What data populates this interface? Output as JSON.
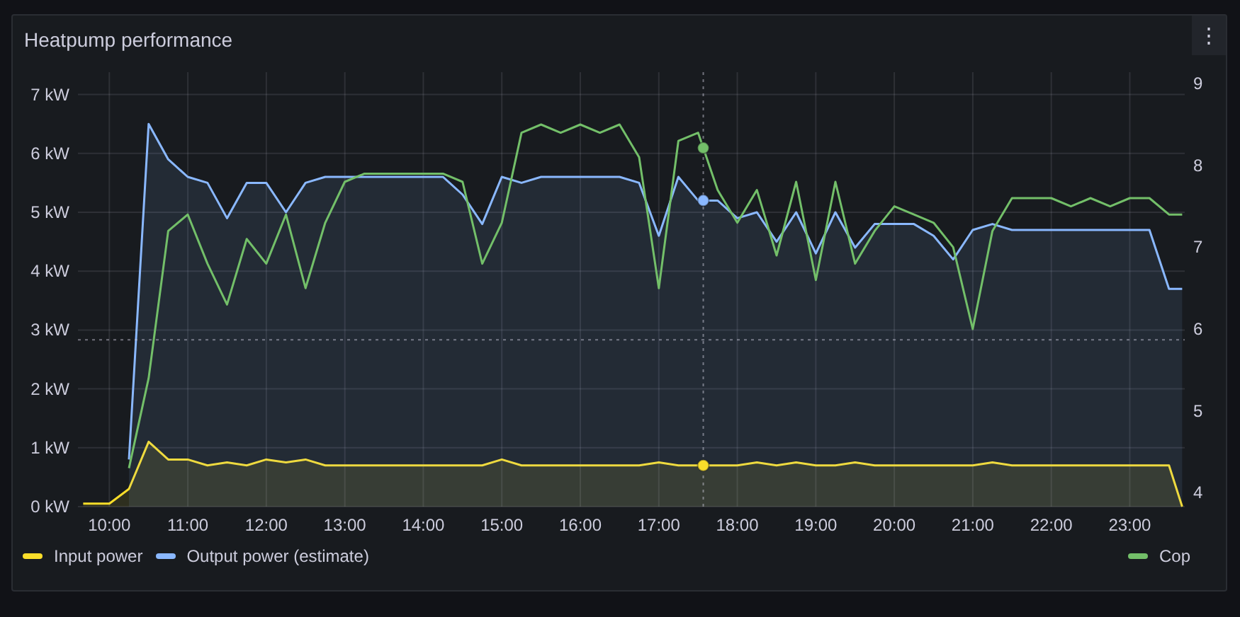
{
  "panel": {
    "title": "Heatpump performance",
    "menu_icon": "⋮",
    "chart_data": {
      "type": "area",
      "x": [
        9.667,
        10,
        10.25,
        10.5,
        10.75,
        11,
        11.25,
        11.5,
        11.75,
        12,
        12.25,
        12.5,
        12.75,
        13,
        13.25,
        13.5,
        13.75,
        14,
        14.25,
        14.5,
        14.75,
        15,
        15.25,
        15.5,
        15.75,
        16,
        16.25,
        16.5,
        16.75,
        17,
        17.25,
        17.5,
        17.75,
        18,
        18.25,
        18.5,
        18.75,
        19,
        19.25,
        19.5,
        19.75,
        20,
        20.25,
        20.5,
        20.75,
        21,
        21.25,
        21.5,
        21.75,
        22,
        22.25,
        22.5,
        22.75,
        23,
        23.25,
        23.5,
        23.667
      ],
      "xlim": [
        9.6,
        23.7
      ],
      "xticks": [
        {
          "value": 10,
          "label": "10:00"
        },
        {
          "value": 11,
          "label": "11:00"
        },
        {
          "value": 12,
          "label": "12:00"
        },
        {
          "value": 13,
          "label": "13:00"
        },
        {
          "value": 14,
          "label": "14:00"
        },
        {
          "value": 15,
          "label": "15:00"
        },
        {
          "value": 16,
          "label": "16:00"
        },
        {
          "value": 17,
          "label": "17:00"
        },
        {
          "value": 18,
          "label": "18:00"
        },
        {
          "value": 19,
          "label": "19:00"
        },
        {
          "value": 20,
          "label": "20:00"
        },
        {
          "value": 21,
          "label": "21:00"
        },
        {
          "value": 22,
          "label": "22:00"
        },
        {
          "value": 23,
          "label": "23:00"
        }
      ],
      "ylim": [
        0,
        7.38
      ],
      "yticks": [
        {
          "value": 0,
          "label": "0 kW"
        },
        {
          "value": 1,
          "label": "1 kW"
        },
        {
          "value": 2,
          "label": "2 kW"
        },
        {
          "value": 3,
          "label": "3 kW"
        },
        {
          "value": 4,
          "label": "4 kW"
        },
        {
          "value": 5,
          "label": "5 kW"
        },
        {
          "value": 6,
          "label": "6 kW"
        },
        {
          "value": 7,
          "label": "7 kW"
        }
      ],
      "y2lim": [
        3.83,
        9.14
      ],
      "y2ticks": [
        {
          "value": 4,
          "label": "4"
        },
        {
          "value": 5,
          "label": "5"
        },
        {
          "value": 6,
          "label": "6"
        },
        {
          "value": 7,
          "label": "7"
        },
        {
          "value": 8,
          "label": "8"
        },
        {
          "value": 9,
          "label": "9"
        }
      ],
      "series": [
        {
          "name": "Input power",
          "color": "#fade2a",
          "values": [
            0.05,
            0.05,
            0.3,
            1.1,
            0.8,
            0.8,
            0.7,
            0.75,
            0.7,
            0.8,
            0.75,
            0.8,
            0.7,
            0.7,
            0.7,
            0.7,
            0.7,
            0.7,
            0.7,
            0.7,
            0.7,
            0.8,
            0.7,
            0.7,
            0.7,
            0.7,
            0.7,
            0.7,
            0.7,
            0.75,
            0.7,
            0.7,
            0.7,
            0.7,
            0.75,
            0.7,
            0.75,
            0.7,
            0.7,
            0.75,
            0.7,
            0.7,
            0.7,
            0.7,
            0.7,
            0.7,
            0.75,
            0.7,
            0.7,
            0.7,
            0.7,
            0.7,
            0.7,
            0.7,
            0.7,
            0.7,
            0.0
          ]
        },
        {
          "name": "Output power (estimate)",
          "color": "#8ab8ff",
          "values": [
            null,
            null,
            0.8,
            6.5,
            5.9,
            5.6,
            5.5,
            4.9,
            5.5,
            5.5,
            5.0,
            5.5,
            5.6,
            5.6,
            5.6,
            5.6,
            5.6,
            5.6,
            5.6,
            5.3,
            4.8,
            5.6,
            5.5,
            5.6,
            5.6,
            5.6,
            5.6,
            5.6,
            5.5,
            4.6,
            5.6,
            5.2,
            5.2,
            4.9,
            5.0,
            4.5,
            5.0,
            4.3,
            5.0,
            4.4,
            4.8,
            4.8,
            4.8,
            4.6,
            4.2,
            4.7,
            4.8,
            4.7,
            4.7,
            4.7,
            4.7,
            4.7,
            4.7,
            4.7,
            4.7,
            3.7,
            3.7
          ]
        },
        {
          "name": "Cop",
          "color": "#73bf69",
          "axis": "y2",
          "type": "line",
          "values": [
            null,
            null,
            4.3,
            5.4,
            7.2,
            7.4,
            6.8,
            6.3,
            7.1,
            6.8,
            7.4,
            6.5,
            7.3,
            7.8,
            7.9,
            7.9,
            7.9,
            7.9,
            7.9,
            7.8,
            6.8,
            7.3,
            8.4,
            8.5,
            8.4,
            8.5,
            8.4,
            8.5,
            8.1,
            6.5,
            8.3,
            8.4,
            7.7,
            7.3,
            7.7,
            6.9,
            7.8,
            6.6,
            7.8,
            6.8,
            7.2,
            7.5,
            7.4,
            7.3,
            7.0,
            6.0,
            7.2,
            7.6,
            7.6,
            7.6,
            7.5,
            7.6,
            7.5,
            7.6,
            7.6,
            7.4,
            7.4
          ]
        }
      ],
      "grid": true
    }
  }
}
